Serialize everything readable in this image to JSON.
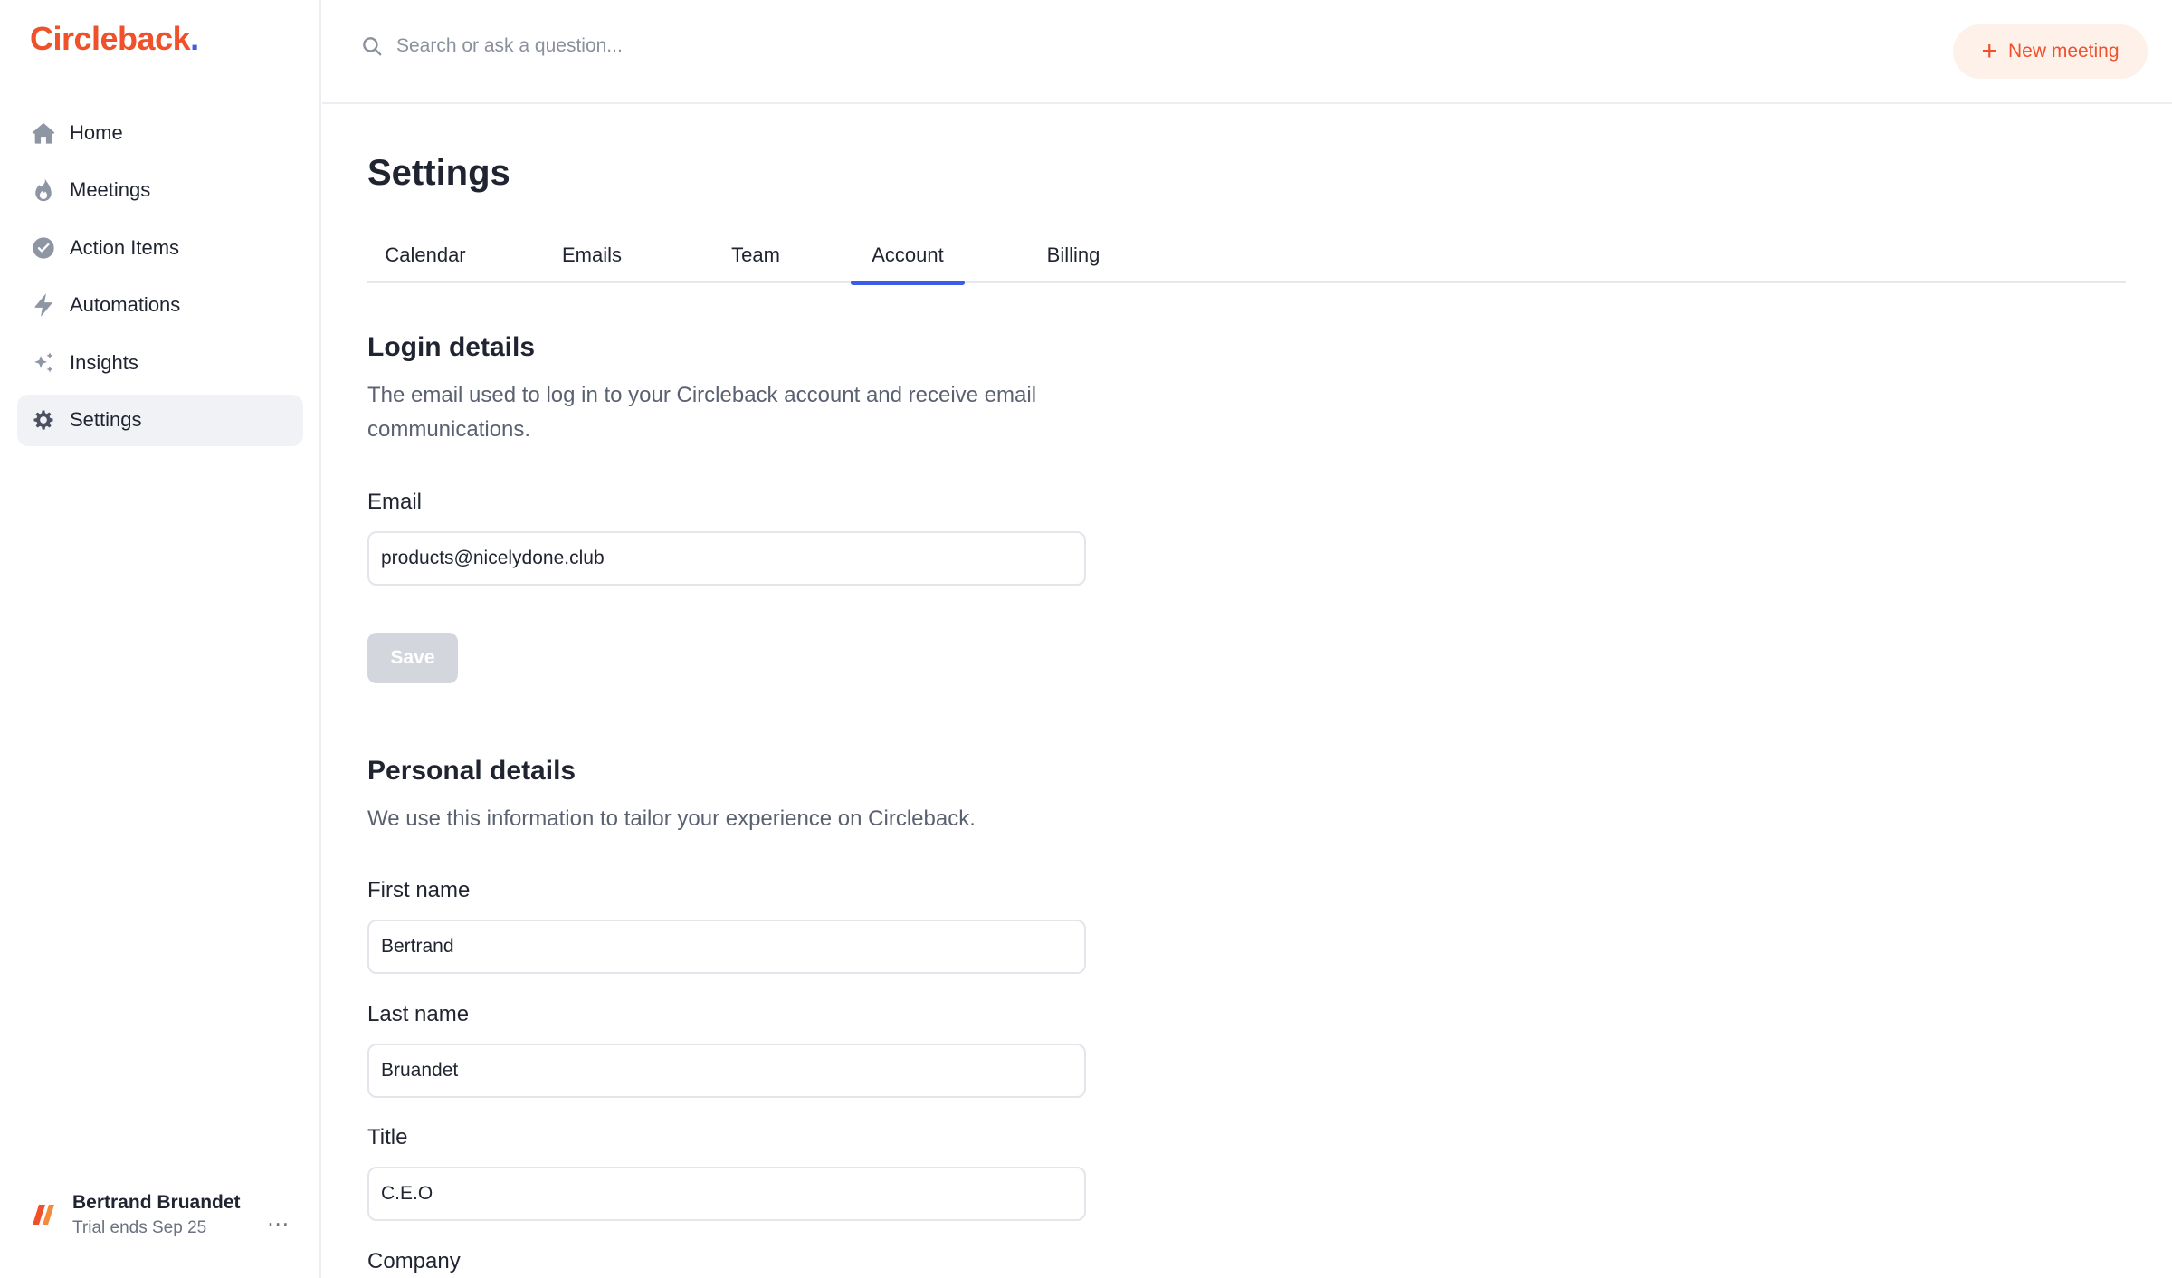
{
  "app": {
    "logo_text": "Circleback",
    "logo_dot": ".",
    "brand_color": "#f0502a",
    "accent_color": "#3b5ce6"
  },
  "sidebar": {
    "items": [
      {
        "label": "Home",
        "icon": "home-icon"
      },
      {
        "label": "Meetings",
        "icon": "flame-icon"
      },
      {
        "label": "Action Items",
        "icon": "check-circle-icon"
      },
      {
        "label": "Automations",
        "icon": "lightning-icon"
      },
      {
        "label": "Insights",
        "icon": "sparkles-icon"
      },
      {
        "label": "Settings",
        "icon": "gear-icon",
        "active": true
      }
    ],
    "user": {
      "name": "Bertrand Bruandet",
      "trial": "Trial ends Sep 25",
      "more": "..."
    }
  },
  "topbar": {
    "search_placeholder": "Search or ask a question...",
    "new_meeting_plus": "+",
    "new_meeting_label": "New meeting"
  },
  "main": {
    "title": "Settings",
    "tabs": [
      {
        "label": "Calendar"
      },
      {
        "label": "Emails"
      },
      {
        "label": "Team"
      },
      {
        "label": "Account",
        "active": true
      },
      {
        "label": "Billing"
      }
    ],
    "login": {
      "title": "Login details",
      "description": "The email used to log in to your Circleback account and receive email communications.",
      "email_label": "Email",
      "email_value": "products@nicelydone.club",
      "save_label": "Save"
    },
    "personal": {
      "title": "Personal details",
      "description": "We use this information to tailor your experience on Circleback.",
      "first_name_label": "First name",
      "first_name_value": "Bertrand",
      "last_name_label": "Last name",
      "last_name_value": "Bruandet",
      "title_label": "Title",
      "title_value": "C.E.O",
      "company_label": "Company"
    }
  }
}
